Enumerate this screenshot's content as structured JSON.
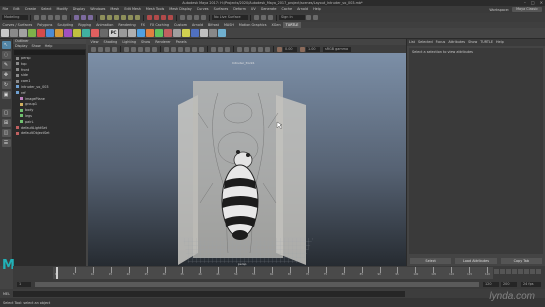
{
  "window": {
    "title": "Autodesk Maya 2017: H:/Projects/2020/Autodesk_Maya_2017_project/scenes/Layout_Intruder_vo_003.mb*",
    "controls": [
      "–",
      "□",
      "✕"
    ]
  },
  "menubar": {
    "items": [
      "File",
      "Edit",
      "Create",
      "Select",
      "Modify",
      "Display",
      "Windows",
      "Mesh",
      "Edit Mesh",
      "Mesh Tools",
      "Mesh Display",
      "Curves",
      "Surfaces",
      "Deform",
      "UV",
      "Generate",
      "Cache",
      "Arnold",
      "Help"
    ],
    "workspace_label": "Workspace:",
    "workspace_value": "Maya Classic"
  },
  "statusline": {
    "mode": "Modeling",
    "live_surface": "No Live Surface",
    "sign_in": "Sign In"
  },
  "shelf": {
    "tabs": [
      "Curves / Surfaces",
      "Polygons",
      "Sculpting",
      "Rigging",
      "Animation",
      "Rendering",
      "FX",
      "FX Caching",
      "Custom",
      "Arnold",
      "Bifrost",
      "MASH",
      "Motion Graphics",
      "XGen",
      "TURTLE"
    ],
    "active_tab": "TURTLE",
    "icons": [
      {
        "name": "shelf-icon-1",
        "color": "#c8c8c8"
      },
      {
        "name": "shelf-icon-2",
        "color": "#8a8a8a"
      },
      {
        "name": "shelf-icon-3",
        "color": "#a2a2a2"
      },
      {
        "name": "shelf-icon-4",
        "color": "#7fb04a"
      },
      {
        "name": "shelf-icon-5",
        "color": "#d44b4b"
      },
      {
        "name": "shelf-icon-6",
        "color": "#4b8bd4"
      },
      {
        "name": "shelf-icon-7",
        "color": "#d49a3a"
      },
      {
        "name": "shelf-icon-8",
        "color": "#a050c0"
      },
      {
        "name": "shelf-icon-9",
        "color": "#c0c040"
      },
      {
        "name": "shelf-icon-10",
        "color": "#40b0a0"
      },
      {
        "name": "shelf-icon-11",
        "color": "#e06060"
      },
      {
        "name": "shelf-icon-12",
        "color": "#6a6a6a"
      },
      {
        "name": "shelf-icon-13",
        "color": "#9a9a9a"
      },
      {
        "name": "shelf-icon-14",
        "color": "#b0b0b0"
      },
      {
        "name": "shelf-icon-15",
        "color": "#50a0e0"
      },
      {
        "name": "shelf-icon-16",
        "color": "#e08040"
      },
      {
        "name": "shelf-icon-17",
        "color": "#60c060"
      },
      {
        "name": "shelf-icon-18",
        "color": "#c06060"
      },
      {
        "name": "shelf-icon-19",
        "color": "#a0a0a0"
      },
      {
        "name": "shelf-icon-20",
        "color": "#d0d050"
      },
      {
        "name": "shelf-icon-21",
        "color": "#5070c0"
      },
      {
        "name": "shelf-icon-22",
        "color": "#c0c0c0"
      },
      {
        "name": "shelf-icon-23",
        "color": "#888888"
      },
      {
        "name": "shelf-icon-24",
        "color": "#70b0d0"
      }
    ],
    "pc_label": "PC"
  },
  "outliner": {
    "title": "Outliner",
    "menus": [
      "Display",
      "Show",
      "Help"
    ],
    "items": [
      {
        "label": "persp",
        "icon": "camera-icon"
      },
      {
        "label": "top",
        "icon": "camera-icon"
      },
      {
        "label": "front",
        "icon": "camera-icon"
      },
      {
        "label": "side",
        "icon": "camera-icon"
      },
      {
        "label": "cam1",
        "icon": "camera-icon"
      },
      {
        "label": "intruder_vo_003",
        "icon": "transform-icon"
      },
      {
        "label": "ref",
        "icon": "transform-icon"
      },
      {
        "label": "imagePlane",
        "icon": "image-icon"
      },
      {
        "label": "group1",
        "icon": "group-icon"
      },
      {
        "label": "body",
        "icon": "mesh-icon"
      },
      {
        "label": "legs",
        "icon": "mesh-icon"
      },
      {
        "label": "pairL",
        "icon": "mesh-icon"
      },
      {
        "label": "defaultLightSet",
        "icon": "set-icon"
      },
      {
        "label": "defaultObjectSet",
        "icon": "set-icon"
      }
    ]
  },
  "viewport": {
    "menus": [
      "View",
      "Shading",
      "Lighting",
      "Show",
      "Renderer",
      "Panels"
    ],
    "camera_label": "Intruder_front1",
    "persp_label": "persp",
    "gamma_value": "1.00",
    "colorspace": "sRGB gamma"
  },
  "attribute_editor": {
    "tabs": [
      "List",
      "Selected",
      "Focus",
      "Attributes",
      "Show",
      "TURTLE",
      "Help"
    ],
    "message": "Select a selection to view attributes",
    "buttons": [
      "Select",
      "Load Attributes",
      "Copy Tab"
    ]
  },
  "timeslider": {
    "ticks": [
      "1",
      "5",
      "10",
      "15",
      "20",
      "25",
      "30",
      "35",
      "40",
      "45",
      "50",
      "55",
      "60",
      "65",
      "70",
      "75",
      "80",
      "85",
      "90",
      "95",
      "100",
      "105",
      "110",
      "115",
      "120"
    ],
    "current_frame": "1",
    "range_start": "1",
    "range_end": "120",
    "anim_end": "200",
    "fps": "24 fps"
  },
  "cmdline": {
    "lang": "MEL"
  },
  "helpline": {
    "text": "Select Tool: select an object"
  },
  "watermark": "lynda.com",
  "logo": "M"
}
